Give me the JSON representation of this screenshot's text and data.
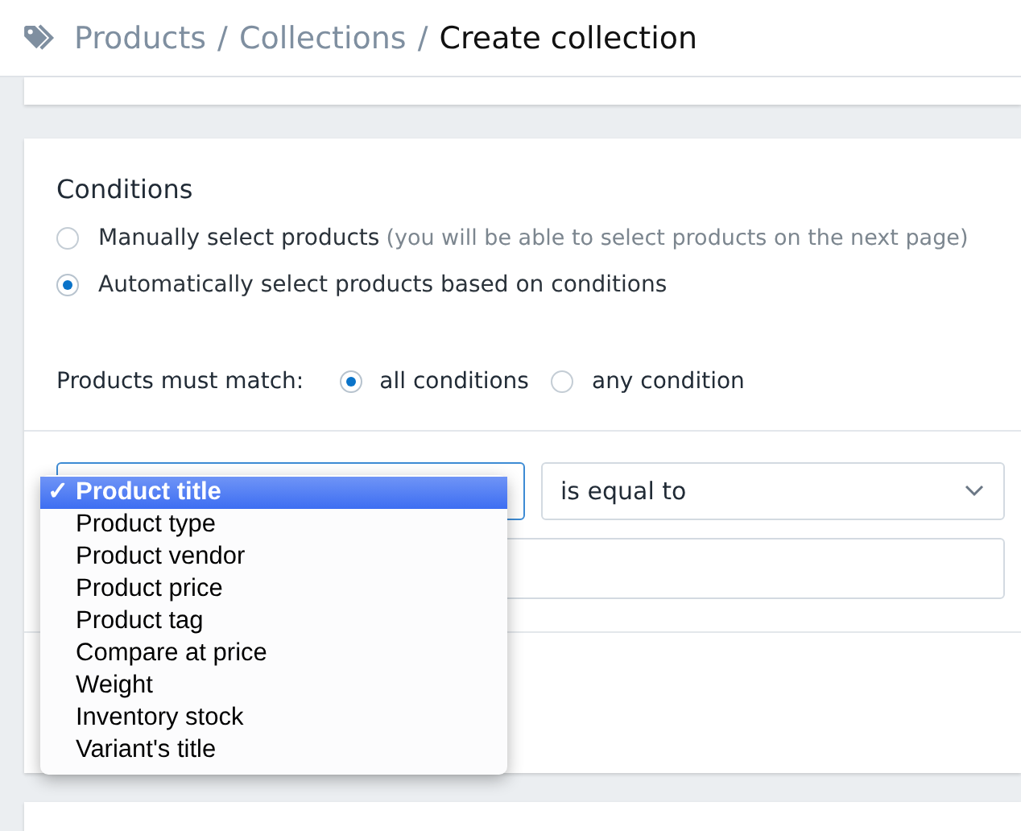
{
  "breadcrumb": [
    {
      "label": "Products",
      "current": false
    },
    {
      "label": "Collections",
      "current": false
    },
    {
      "label": "Create collection",
      "current": true
    }
  ],
  "breadcrumb_separator": "/",
  "conditions": {
    "title": "Conditions",
    "modes": [
      {
        "label": "Manually select products",
        "note": "(you will be able to select products on the next page)",
        "selected": false
      },
      {
        "label": "Automatically select products based on conditions",
        "selected": true
      }
    ],
    "match_label": "Products must match:",
    "match_options": [
      {
        "label": "all conditions",
        "selected": true
      },
      {
        "label": "any condition",
        "selected": false
      }
    ],
    "operator_select": {
      "value": "is equal to"
    },
    "field_menu": {
      "check": "✓",
      "items": [
        {
          "label": "Product title",
          "selected": true
        },
        {
          "label": "Product type",
          "selected": false
        },
        {
          "label": "Product vendor",
          "selected": false
        },
        {
          "label": "Product price",
          "selected": false
        },
        {
          "label": "Product tag",
          "selected": false
        },
        {
          "label": "Compare at price",
          "selected": false
        },
        {
          "label": "Weight",
          "selected": false
        },
        {
          "label": "Inventory stock",
          "selected": false
        },
        {
          "label": "Variant's title",
          "selected": false
        }
      ]
    }
  }
}
